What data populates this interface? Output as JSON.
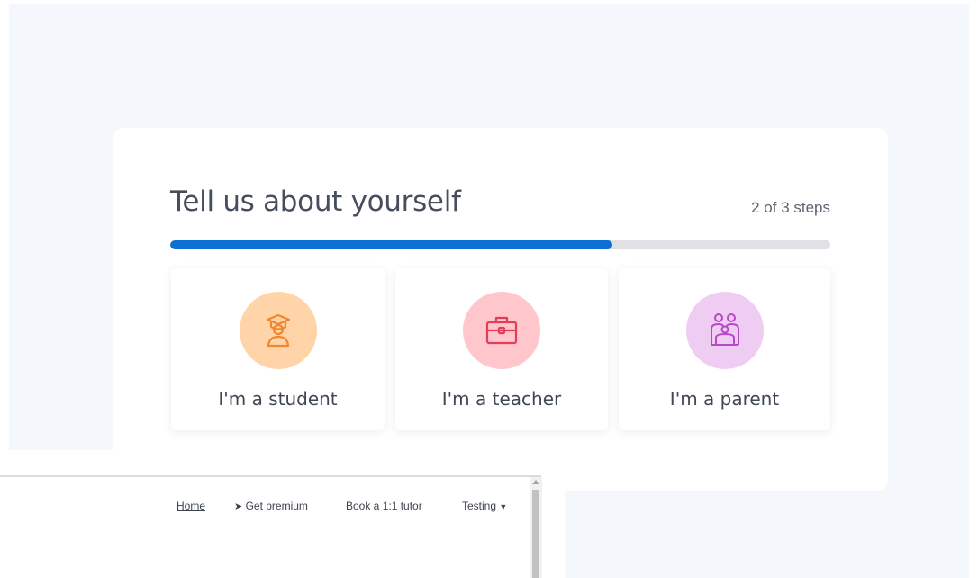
{
  "onboarding": {
    "title": "Tell us about yourself",
    "steps_text": "2 of 3 steps",
    "progress": 0.67,
    "progress_color": "#0b6fd3",
    "roles": [
      {
        "label": "I'm a student",
        "icon": "student-graduate-icon",
        "bg": "#ffd4a8",
        "fg": "#f3862d"
      },
      {
        "label": "I'm a teacher",
        "icon": "briefcase-icon",
        "bg": "#ffc6cc",
        "fg": "#e23e58"
      },
      {
        "label": "I'm a parent",
        "icon": "family-icon",
        "bg": "#efcdf2",
        "fg": "#b648c9"
      }
    ]
  },
  "nav": {
    "home": "Home",
    "premium": "Get premium",
    "tutor": "Book a 1:1 tutor",
    "testing": "Testing"
  }
}
